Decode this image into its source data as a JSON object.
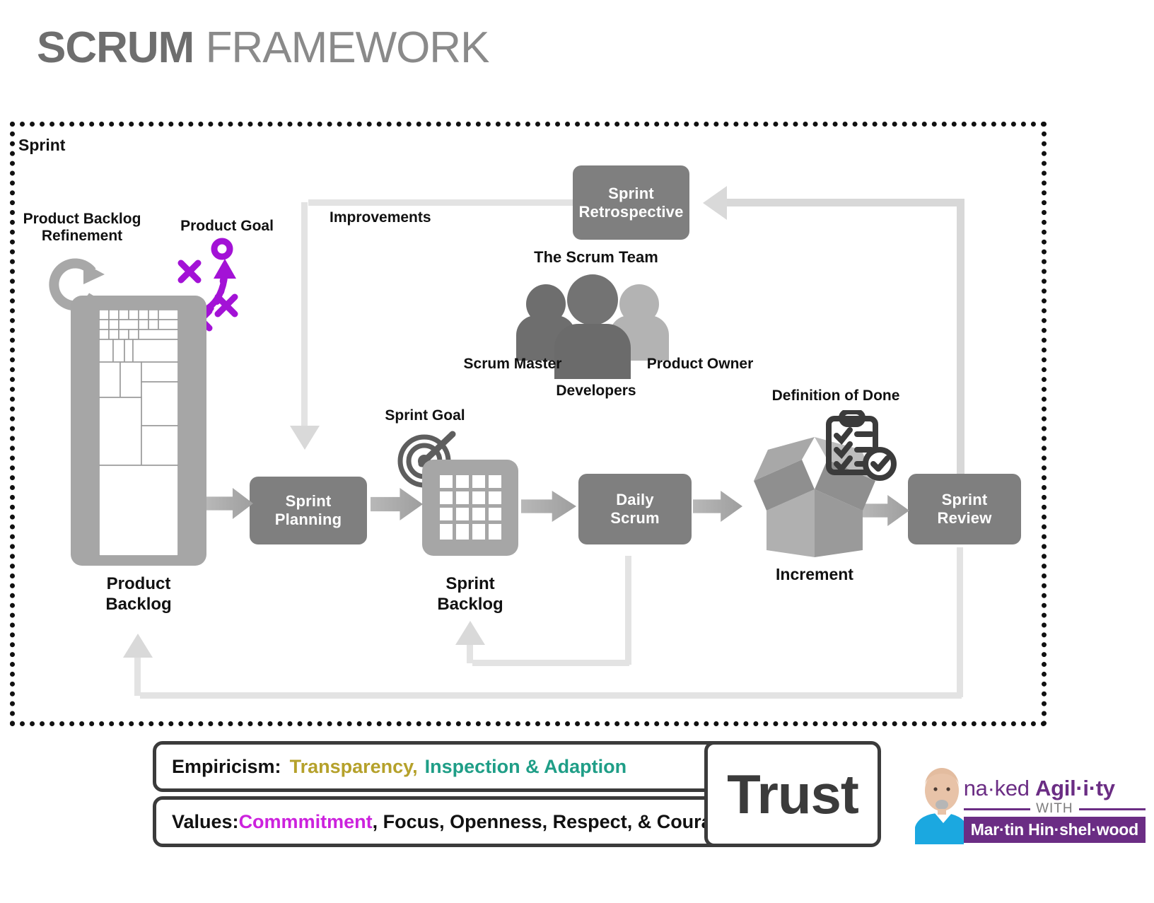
{
  "title": {
    "bold": "SCRUM",
    "light": "FRAMEWORK"
  },
  "sprint": {
    "label": "Sprint"
  },
  "labels": {
    "product_backlog_refinement": "Product Backlog\nRefinement",
    "product_backlog_refinement_l1": "Product Backlog",
    "product_backlog_refinement_l2": "Refinement",
    "product_goal": "Product Goal",
    "product_backlog_l1": "Product",
    "product_backlog_l2": "Backlog",
    "improvements": "Improvements",
    "sprint_goal": "Sprint Goal",
    "sprint_backlog_l1": "Sprint",
    "sprint_backlog_l2": "Backlog",
    "the_scrum_team": "The Scrum Team",
    "scrum_master": "Scrum Master",
    "product_owner": "Product Owner",
    "developers": "Developers",
    "definition_of_done": "Definition of Done",
    "increment": "Increment"
  },
  "events": [
    {
      "id": "sprint-retrospective",
      "l1": "Sprint",
      "l2": "Retrospective"
    },
    {
      "id": "sprint-planning",
      "l1": "Sprint",
      "l2": "Planning"
    },
    {
      "id": "daily-scrum",
      "l1": "Daily",
      "l2": "Scrum"
    },
    {
      "id": "sprint-review",
      "l1": "Sprint",
      "l2": "Review"
    }
  ],
  "empiricism": {
    "label": "Empiricism:",
    "pillar1": "Transparency,",
    "pillar2": "Inspection & Adaption"
  },
  "values": {
    "label": "Values:",
    "first": "Commmitment",
    "rest": ", Focus, Openness, Respect, & Courage"
  },
  "trust": {
    "label": "Trust"
  },
  "logo": {
    "name_a": "na·ked ",
    "name_b": "Agil·i·ty",
    "with": "WITH",
    "person": "Mar·tin Hin·shel·wood"
  },
  "colors": {
    "title_bold": "#6e6e6e",
    "title_light": "#8a8a8a",
    "event_box": "#7f7f7f",
    "artifact_panel": "#a6a6a6",
    "accent_purple": "#a312d6",
    "transparency_gold": "#b5a12b",
    "inspection_teal": "#1f9e87",
    "commitment_magenta": "#cc22dd",
    "brand_purple": "#6b2d84",
    "border_dark": "#3b3b3b",
    "connector_gray": "#e3e3e3"
  }
}
